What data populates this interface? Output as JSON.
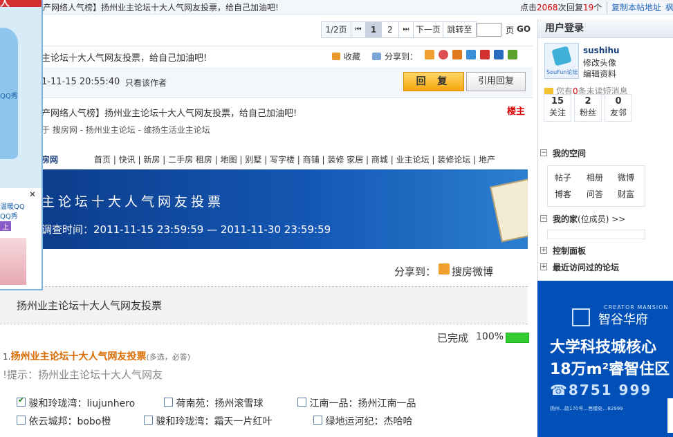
{
  "topbar": {
    "title": "产网络人气榜】扬州业主论坛十大人气网友投票，给自己加油吧!",
    "clicks_prefix": "点击",
    "clicks": "2068",
    "clicks_suffix": "次",
    "replies_prefix": "回复",
    "replies": "19",
    "replies_suffix": "个",
    "copy_link": "复制本帖地址",
    "extra": "枫"
  },
  "left_ad": {
    "header": "人",
    "text1": "QQ秀",
    "text2": "温暖QQ",
    "text3": "QQ秀",
    "text4": "上",
    "close": "✕"
  },
  "pager": {
    "pages": "1/2页",
    "current": "1",
    "page2": "2",
    "next": "下一页",
    "jump": "跳转至",
    "page_unit": "页",
    "go": "GO"
  },
  "post_header": {
    "title": "主论坛十大人气网友投票，给自己加油吧!",
    "favorite": "收藏",
    "share": "分享到："
  },
  "post_meta": {
    "datetime": "1-11-15 20:55:40",
    "only_author": "只看该作者",
    "reply": "回 复",
    "quote_reply": "引用回复"
  },
  "post": {
    "title": "产网络人气榜】扬州业主论坛十大人气网友投票，给自己加油吧!",
    "floor": "楼主",
    "source": "于 搜房网 - 扬州业主论坛 - 维扬生活业主论坛",
    "site_short": "房网",
    "nav": [
      "首页",
      "快讯",
      "新房",
      "二手房",
      "租房",
      "地图",
      "别墅",
      "写字楼",
      "商铺",
      "装修",
      "家居",
      "商城",
      "业主论坛",
      "装修论坛",
      "地产"
    ]
  },
  "banner": {
    "title": "主论坛十大人气网友投票",
    "period": "调查时间：2011-11-15 23:59:59 — 2011-11-30 23:59:59"
  },
  "share": {
    "label": "分享到：",
    "weibo": "搜房微博"
  },
  "vote": {
    "title": "扬州业主论坛十大人气网友投票",
    "status": "已完成",
    "percent": "100%",
    "progress": 1.0,
    "q_num": "1.",
    "question": "扬州业主论坛十大人气网友投票",
    "rule": "(多选，必答)",
    "hint": "!提示：扬州业主论坛十大人气网友",
    "options": [
      {
        "label": "骏和玲珑湾：liujunhero",
        "checked": true
      },
      {
        "label": "荷南苑：扬州滚雪球",
        "checked": false
      },
      {
        "label": "江南一品：扬州江南一品",
        "checked": false
      },
      {
        "label": "依云城邦：bobo橙",
        "checked": false
      },
      {
        "label": "骏和玲珑湾：霜天一片红叶",
        "checked": false
      },
      {
        "label": "绿地运河纪：杰哈哈",
        "checked": false
      }
    ]
  },
  "sidebar": {
    "title": "用户登录",
    "username": "sushihu",
    "avatar_brand": "SouFun论坛",
    "change_avatar": "修改头像",
    "edit_profile": "编辑资料",
    "msg_prefix": "您有",
    "msg_count": "0",
    "msg_suffix": "条未读短消息",
    "stats": [
      {
        "num": "15",
        "label": "关注"
      },
      {
        "num": "2",
        "label": "粉丝"
      },
      {
        "num": "0",
        "label": "友邻"
      }
    ],
    "my_space": "我的空间",
    "space_items": [
      "帖子",
      "相册",
      "微博",
      "博客",
      "问答",
      "财富"
    ],
    "my_home": "我的家",
    "my_home_suffix": "(位成员) >>",
    "control_panel": "控制面板",
    "recent_forums": "最近访问过的论坛"
  },
  "right_ad": {
    "brand_en": "CREATOR MANSION",
    "brand_cn": "智谷华府",
    "line1": "大学科技城核心",
    "line2": "18万m²睿智住区",
    "phone": "☎8751  999",
    "address": "扬州…路170号…售楼处…82999"
  },
  "colors": {
    "accent_blue": "#2a6bbf",
    "banner_blue": "#1457b3",
    "floor_red": "#d80000",
    "progress_green": "#33cc33",
    "reply_orange": "#f5a50a"
  }
}
